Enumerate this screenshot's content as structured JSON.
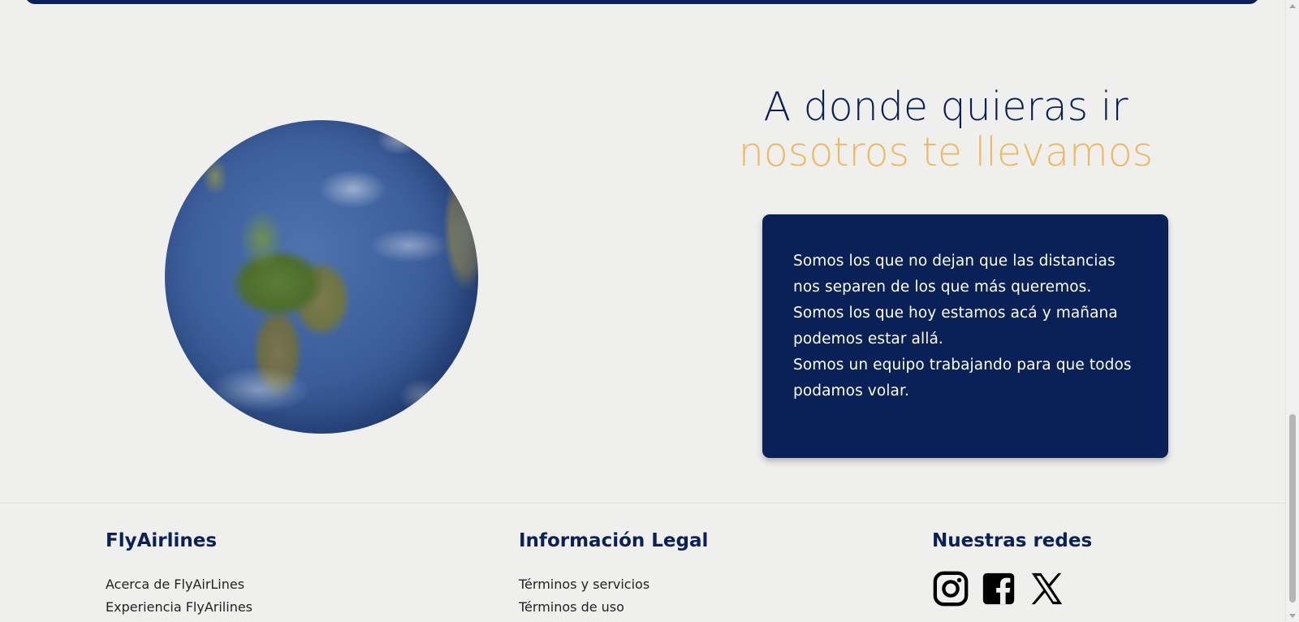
{
  "headline": {
    "line1": "A donde quieras ir",
    "line2": "nosotros te llevamos"
  },
  "intro_card": {
    "paragraphs": [
      "Somos los que no dejan que las distancias nos separen de los que más queremos.",
      "Somos los que hoy estamos acá y mañana podemos estar allá.",
      "Somos un equipo trabajando para que todos podamos volar."
    ]
  },
  "footer": {
    "brand": {
      "title": "FlyAirlines",
      "links": [
        "Acerca de FlyAirLines",
        "Experiencia FlyArilines"
      ]
    },
    "legal": {
      "title": "Información Legal",
      "links": [
        "Términos y servicios",
        "Términos de uso"
      ]
    },
    "social": {
      "title": "Nuestras redes",
      "icons": [
        "instagram-icon",
        "facebook-icon",
        "x-icon"
      ]
    }
  },
  "colors": {
    "navy": "#0a2157",
    "accent": "#efb862",
    "background": "#efefee"
  }
}
